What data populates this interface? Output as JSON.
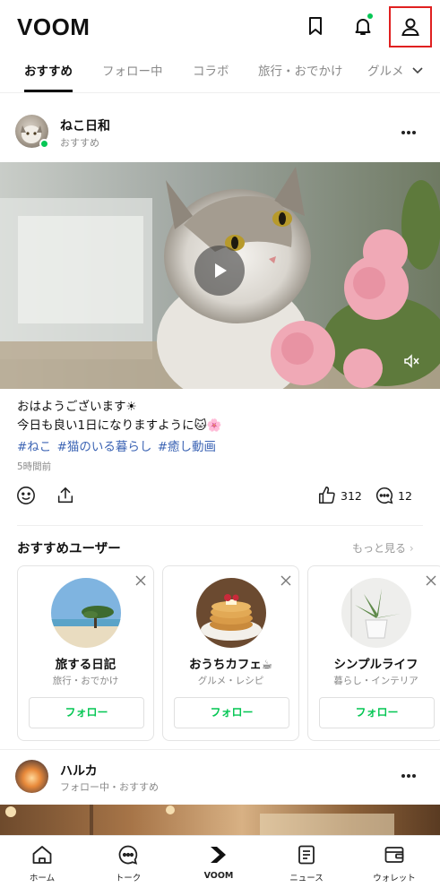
{
  "header": {
    "logo": "VOOM",
    "icons": [
      "bookmark-icon",
      "bell-icon",
      "profile-icon"
    ],
    "colors": {
      "accent": "#06c755",
      "highlight": "#e02020"
    }
  },
  "tabs": [
    {
      "label": "おすすめ",
      "active": true
    },
    {
      "label": "フォロー中",
      "active": false
    },
    {
      "label": "コラボ",
      "active": false
    },
    {
      "label": "旅行・おでかけ",
      "active": false
    },
    {
      "label": "グルメ",
      "active": false
    }
  ],
  "post": {
    "author": "ねこ日和",
    "subtitle": "おすすめ",
    "caption_line1": "おはようございます☀",
    "caption_line2": "今日も良い1日になりますように🐱🌸",
    "hashtags": [
      "#ねこ",
      "#猫のいる暮らし",
      "#癒し動画"
    ],
    "time": "5時間前",
    "likes": "312",
    "comments": "12"
  },
  "recommended": {
    "title": "おすすめユーザー",
    "more": "もっと見る",
    "users": [
      {
        "name": "旅する日記",
        "category": "旅行・おでかけ",
        "follow": "フォロー"
      },
      {
        "name": "おうちカフェ☕",
        "category": "グルメ・レシピ",
        "follow": "フォロー"
      },
      {
        "name": "シンプルライフ",
        "category": "暮らし・インテリア",
        "follow": "フォロー"
      }
    ]
  },
  "post2": {
    "author": "ハルカ",
    "subtitle": "フォロー中・おすすめ"
  },
  "bottom_nav": [
    {
      "label": "ホーム",
      "icon": "home-icon"
    },
    {
      "label": "トーク",
      "icon": "chat-icon"
    },
    {
      "label": "VOOM",
      "icon": "voom-icon",
      "active": true
    },
    {
      "label": "ニュース",
      "icon": "news-icon"
    },
    {
      "label": "ウォレット",
      "icon": "wallet-icon"
    }
  ]
}
